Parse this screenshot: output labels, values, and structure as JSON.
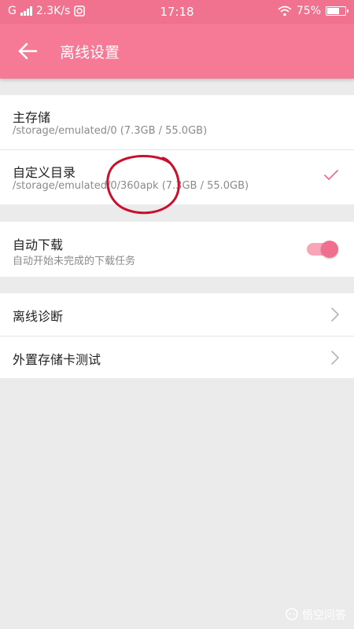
{
  "colors": {
    "statusbar": "#f0728f",
    "appbar": "#f67a95",
    "accent": "#f06f8d",
    "background": "#ebebeb"
  },
  "statusbar": {
    "network": "G",
    "speed": "2.3K/s",
    "time": "17:18",
    "battery_percent": "75%",
    "battery_level": 0.75
  },
  "appbar": {
    "back_icon": "arrow-left-icon",
    "title": "离线设置"
  },
  "storage": {
    "items": [
      {
        "title": "主存储",
        "subtitle": "/storage/emulated/0 (7.3GB / 55.0GB)",
        "selected": false
      },
      {
        "title": "自定义目录",
        "subtitle": "/storage/emulated/0/360apk (7.3GB / 55.0GB)",
        "selected": true
      }
    ]
  },
  "auto_download": {
    "title": "自动下载",
    "subtitle": "自动开始未完成的下载任务",
    "enabled": true
  },
  "tools": {
    "items": [
      {
        "label": "离线诊断"
      },
      {
        "label": "外置存储卡测试"
      }
    ]
  },
  "watermark": {
    "text": "悟空问答"
  }
}
